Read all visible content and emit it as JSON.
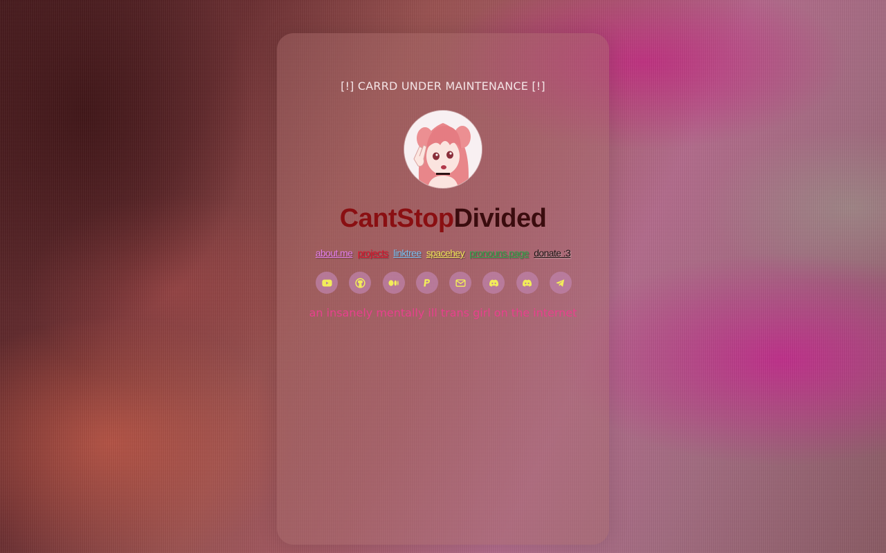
{
  "notice": "[!] CARRD UNDER MAINTENANCE [!]",
  "title": {
    "part1": "CantStop",
    "part2": "Divided"
  },
  "links": [
    {
      "label": "about.me",
      "color": "#e47fe9"
    },
    {
      "label": "projects",
      "color": "#e0142c"
    },
    {
      "label": "linktree",
      "color": "#7cc0f0"
    },
    {
      "label": "spacehey",
      "color": "#f2e65a"
    },
    {
      "label": "pronouns.page",
      "color": "#2ea84a"
    },
    {
      "label": "donate :3",
      "color": "#1a1010"
    }
  ],
  "social_icons": [
    "youtube-icon",
    "github-icon",
    "medium-icon",
    "paypal-icon",
    "email-icon",
    "discord-icon",
    "discord-icon",
    "telegram-icon"
  ],
  "icon_color": "#f2ec5a",
  "tagline": "an insanely mentally ill trans girl on the internet"
}
